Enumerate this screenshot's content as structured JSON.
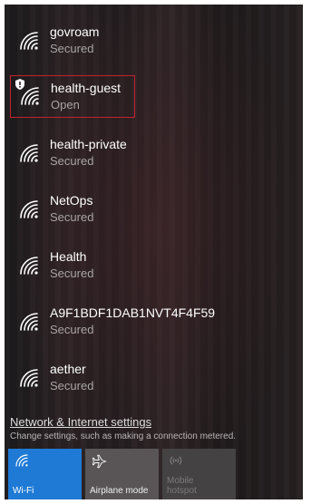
{
  "networks": [
    {
      "ssid": "govroam",
      "status": "Secured"
    },
    {
      "ssid": "health-guest",
      "status": "Open",
      "selected": true,
      "shield": true
    },
    {
      "ssid": "health-private",
      "status": "Secured"
    },
    {
      "ssid": "NetOps",
      "status": "Secured"
    },
    {
      "ssid": "Health",
      "status": "Secured"
    },
    {
      "ssid": "A9F1BDF1DAB1NVT4F4F59",
      "status": "Secured"
    },
    {
      "ssid": "aether",
      "status": "Secured"
    }
  ],
  "settings": {
    "link_label": "Network & Internet settings",
    "description": "Change settings, such as making a connection metered."
  },
  "quick_actions": {
    "wifi_label": "Wi-Fi",
    "airplane_label": "Airplane mode",
    "hotspot_label_line1": "Mobile",
    "hotspot_label_line2": "hotspot"
  },
  "colors": {
    "accent": "#1f7ad6",
    "selection_border": "#c4222e"
  },
  "icons": {
    "network": "wifi-signal-icon",
    "shield": "shield-icon",
    "airplane": "airplane-icon",
    "hotspot": "hotspot-icon"
  }
}
